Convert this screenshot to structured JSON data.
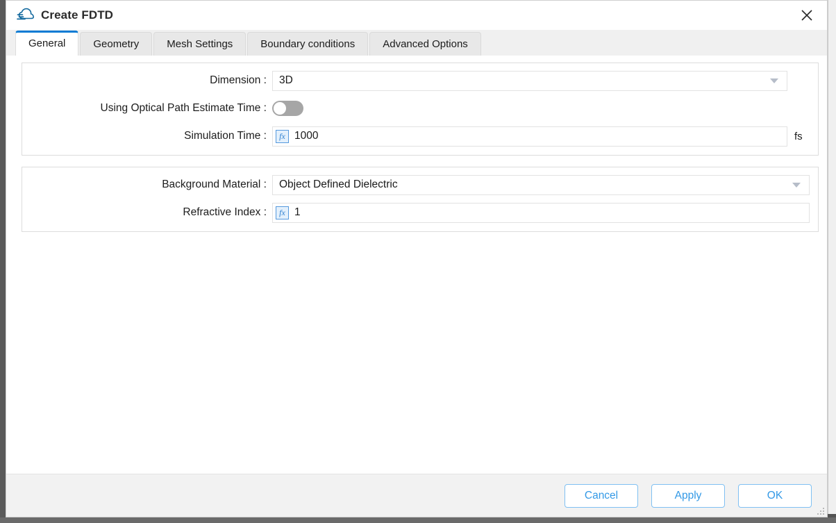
{
  "window": {
    "title": "Create FDTD",
    "icon": "cloud-icon",
    "close_icon": "close-icon"
  },
  "tabs": [
    {
      "label": "General",
      "active": true
    },
    {
      "label": "Geometry",
      "active": false
    },
    {
      "label": "Mesh Settings",
      "active": false
    },
    {
      "label": "Boundary conditions",
      "active": false
    },
    {
      "label": "Advanced Options",
      "active": false
    }
  ],
  "groups": [
    {
      "rows": [
        {
          "label": "Dimension :",
          "type": "combo",
          "value": "3D",
          "unit": ""
        },
        {
          "label": "Using Optical Path Estimate Time :",
          "type": "toggle",
          "value": "off",
          "unit": ""
        },
        {
          "label": "Simulation Time :",
          "type": "field",
          "value": "1000",
          "fx": "fx",
          "unit": "fs"
        }
      ]
    },
    {
      "rows": [
        {
          "label": "Background Material :",
          "type": "combo",
          "value": "Object Defined Dielectric",
          "unit": ""
        },
        {
          "label": "Refractive Index :",
          "type": "field",
          "value": "1",
          "fx": "fx",
          "unit": ""
        }
      ]
    }
  ],
  "footer": {
    "buttons": [
      {
        "label": "Cancel",
        "name": "cancel-button"
      },
      {
        "label": "Apply",
        "name": "apply-button"
      },
      {
        "label": "OK",
        "name": "ok-button"
      }
    ]
  },
  "colors": {
    "accent": "#0a7bd4",
    "button_text": "#3399e6",
    "button_border": "#7fc0f2",
    "footer_bg": "#f2f2f2",
    "tab_inactive_bg": "#e8e8e8"
  }
}
